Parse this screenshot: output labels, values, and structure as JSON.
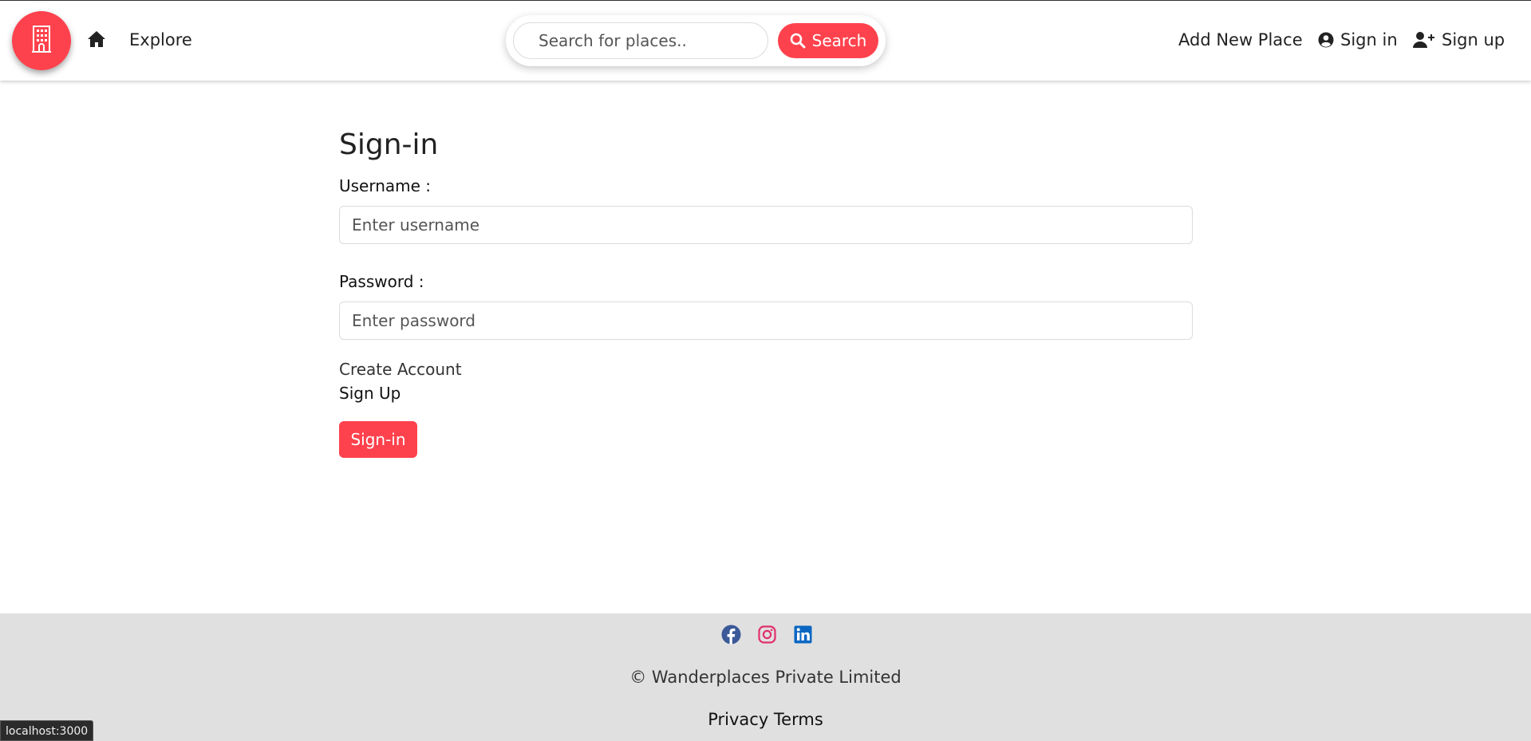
{
  "colors": {
    "brand": "#fe424d",
    "footer_bg": "#e0e0e0",
    "facebook": "#3b5998",
    "instagram": "#e1306c",
    "linkedin": "#0a66c2"
  },
  "navbar": {
    "logo_icon": "building-icon",
    "home_icon": "home-icon",
    "explore_label": "Explore",
    "search": {
      "placeholder": "Search for places..",
      "button_label": "Search",
      "button_icon": "search-icon"
    },
    "add_new_place_label": "Add New Place",
    "signin_label": "Sign in",
    "signin_icon": "user-circle-icon",
    "signup_label": "Sign up",
    "signup_icon": "user-plus-icon"
  },
  "form": {
    "title": "Sign-in",
    "username_label": "Username :",
    "username_placeholder": "Enter username",
    "password_label": "Password :",
    "password_placeholder": "Enter password",
    "create_account_text": "Create Account",
    "signup_link": "Sign Up",
    "submit_label": "Sign-in"
  },
  "footer": {
    "social_icons": [
      "facebook-icon",
      "instagram-icon",
      "linkedin-icon"
    ],
    "copyright": "© Wanderplaces Private Limited",
    "links_text": "Privacy Terms"
  },
  "status_bar": {
    "url": "localhost:3000"
  }
}
